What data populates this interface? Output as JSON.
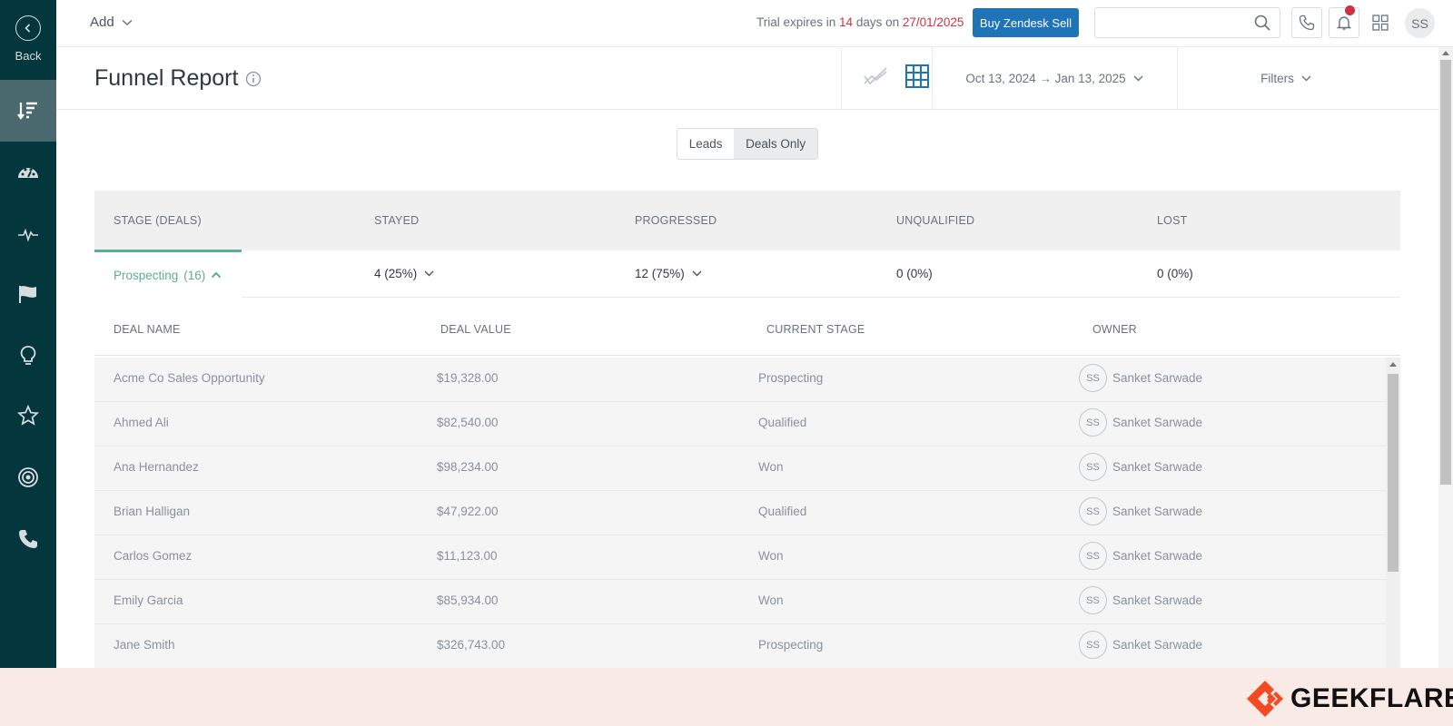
{
  "sidebar": {
    "back_label": "Back",
    "items": [
      {
        "icon": "sort-icon",
        "active": true
      },
      {
        "icon": "dashboard-icon"
      },
      {
        "icon": "activity-icon"
      },
      {
        "icon": "flag-icon"
      },
      {
        "icon": "lightbulb-icon"
      },
      {
        "icon": "star-icon"
      },
      {
        "icon": "target-icon"
      },
      {
        "icon": "phone-icon"
      }
    ]
  },
  "topbar": {
    "add_label": "Add",
    "trial_prefix": "Trial expires in ",
    "trial_days": "14",
    "trial_mid": " days on ",
    "trial_date": "27/01/2025",
    "buy_label": "Buy Zendesk Sell",
    "search_placeholder": "",
    "user_initials": "SS"
  },
  "header": {
    "title": "Funnel Report",
    "date_range": "Oct 13, 2024 → Jan 13, 2025",
    "filters_label": "Filters"
  },
  "toggle": {
    "option1": "Leads",
    "option2": "Deals Only",
    "selected": "Deals Only"
  },
  "stage_table": {
    "headers": [
      "STAGE (DEALS)",
      "STAYED",
      "PROGRESSED",
      "UNQUALIFIED",
      "LOST"
    ],
    "row": {
      "stage": "Prospecting",
      "count": "(16)",
      "stayed": "4",
      "stayed_pct": "(25%)",
      "progressed": "12",
      "progressed_pct": "(75%)",
      "unqualified": "0",
      "unqualified_pct": "(0%)",
      "lost": "0",
      "lost_pct": "(0%)"
    }
  },
  "deals_table": {
    "headers": [
      "DEAL NAME",
      "DEAL VALUE",
      "CURRENT STAGE",
      "OWNER"
    ],
    "rows": [
      {
        "name": "Acme Co Sales Opportunity",
        "value": "$19,328.00",
        "stage": "Prospecting",
        "owner_initials": "SS",
        "owner": "Sanket Sarwade"
      },
      {
        "name": "Ahmed Ali",
        "value": "$82,540.00",
        "stage": "Qualified",
        "owner_initials": "SS",
        "owner": "Sanket Sarwade"
      },
      {
        "name": "Ana Hernandez",
        "value": "$98,234.00",
        "stage": "Won",
        "owner_initials": "SS",
        "owner": "Sanket Sarwade"
      },
      {
        "name": "Brian Halligan",
        "value": "$47,922.00",
        "stage": "Qualified",
        "owner_initials": "SS",
        "owner": "Sanket Sarwade"
      },
      {
        "name": "Carlos Gomez",
        "value": "$11,123.00",
        "stage": "Won",
        "owner_initials": "SS",
        "owner": "Sanket Sarwade"
      },
      {
        "name": "Emily Garcia",
        "value": "$85,934.00",
        "stage": "Won",
        "owner_initials": "SS",
        "owner": "Sanket Sarwade"
      },
      {
        "name": "Jane Smith",
        "value": "$326,743.00",
        "stage": "Prospecting",
        "owner_initials": "SS",
        "owner": "Sanket Sarwade"
      }
    ]
  },
  "footer": {
    "brand": "GEEKFLARE"
  },
  "colors": {
    "sidebar_bg": "#03363d",
    "accent_blue": "#1f73b7",
    "accent_green": "#5eae91",
    "alert_red": "#cc3340",
    "brand_orange": "#f04b23"
  }
}
